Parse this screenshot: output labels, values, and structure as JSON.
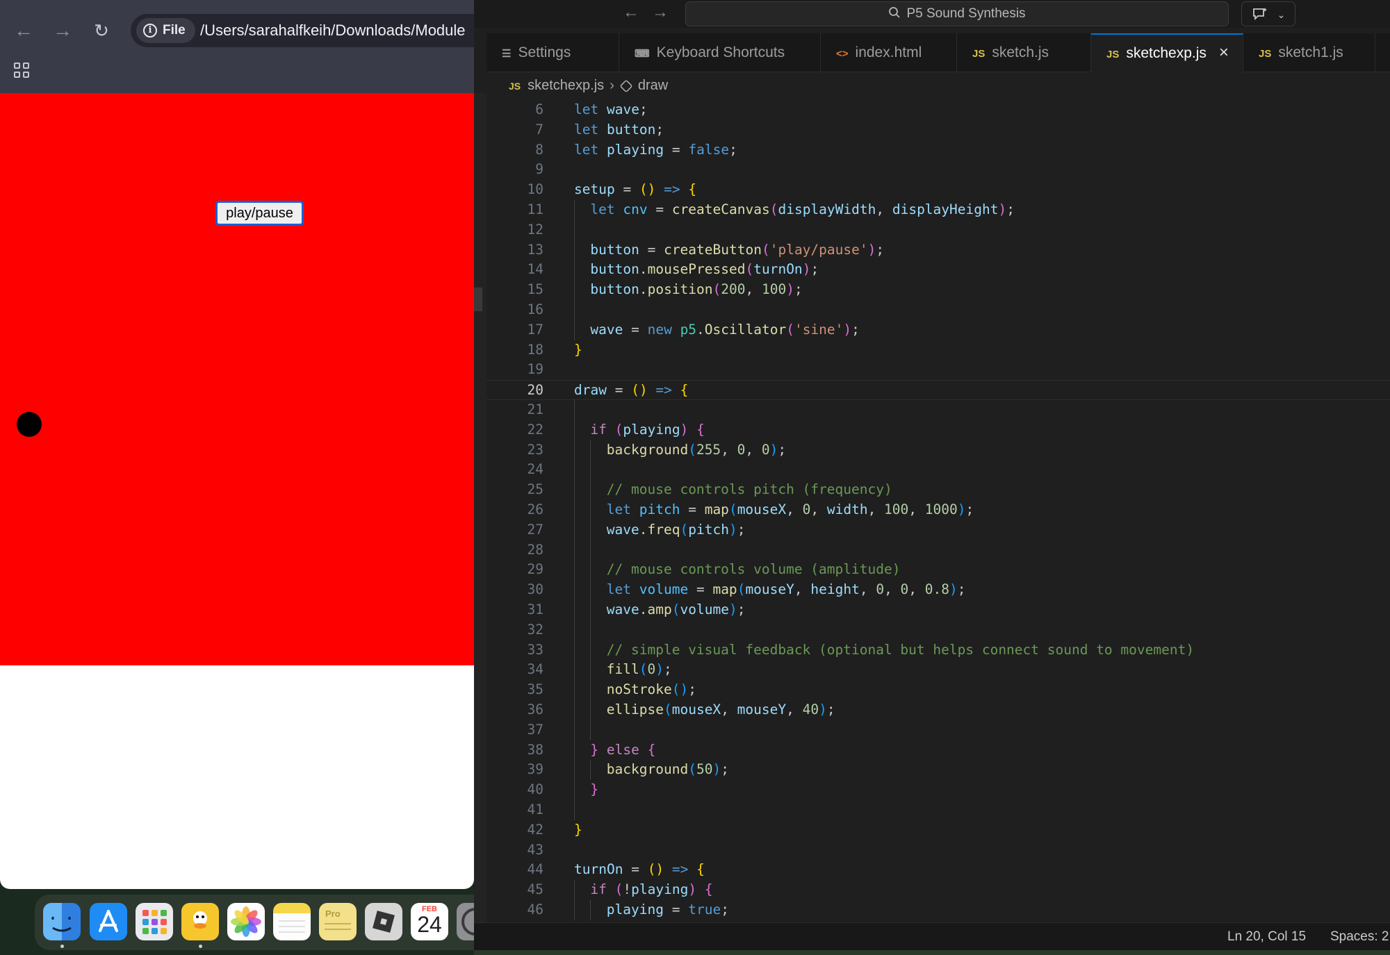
{
  "browser": {
    "file_chip_label": "File",
    "url": "/Users/sarahalfkeih/Downloads/Module",
    "canvas_bg": "#ff0000",
    "play_button_label": "play/pause"
  },
  "dock": {
    "calendar_month": "FEB",
    "calendar_day": "24",
    "notes_label": "Pro"
  },
  "vscode": {
    "command_center": "P5 Sound Synthesis",
    "tabs": [
      {
        "label": "Settings",
        "icon": "gear-icon"
      },
      {
        "label": "Keyboard Shortcuts",
        "icon": "keyboard-icon"
      },
      {
        "label": "index.html",
        "icon": "html-icon"
      },
      {
        "label": "sketch.js",
        "icon": "js-icon"
      },
      {
        "label": "sketchexp.js",
        "icon": "js-icon",
        "active": true
      },
      {
        "label": "sketch1.js",
        "icon": "js-icon"
      }
    ],
    "breadcrumb": {
      "file": "sketchexp.js",
      "symbol": "draw"
    },
    "status": {
      "position": "Ln 20, Col 15",
      "spaces": "Spaces: 2"
    }
  },
  "code_lines": [
    {
      "n": "6",
      "indent": 0,
      "t": [
        [
          "kw",
          "let "
        ],
        [
          "var",
          "wave"
        ],
        [
          "p",
          ";"
        ]
      ]
    },
    {
      "n": "7",
      "indent": 0,
      "t": [
        [
          "kw",
          "let "
        ],
        [
          "var",
          "button"
        ],
        [
          "p",
          ";"
        ]
      ]
    },
    {
      "n": "8",
      "indent": 0,
      "t": [
        [
          "kw",
          "let "
        ],
        [
          "var",
          "playing"
        ],
        [
          "p",
          " = "
        ],
        [
          "kw",
          "false"
        ],
        [
          "p",
          ";"
        ]
      ]
    },
    {
      "n": "9",
      "indent": 0,
      "t": []
    },
    {
      "n": "10",
      "indent": 0,
      "t": [
        [
          "var",
          "setup"
        ],
        [
          "p",
          " = "
        ],
        [
          "b1",
          "()"
        ],
        [
          "kw",
          " => "
        ],
        [
          "b1",
          "{"
        ]
      ]
    },
    {
      "n": "11",
      "indent": 1,
      "t": [
        [
          "kw",
          "let "
        ],
        [
          "const",
          "cnv"
        ],
        [
          "p",
          " = "
        ],
        [
          "fn",
          "createCanvas"
        ],
        [
          "b2",
          "("
        ],
        [
          "var",
          "displayWidth"
        ],
        [
          "p",
          ", "
        ],
        [
          "var",
          "displayHeight"
        ],
        [
          "b2",
          ")"
        ],
        [
          "p",
          ";"
        ]
      ]
    },
    {
      "n": "12",
      "indent": 1,
      "t": []
    },
    {
      "n": "13",
      "indent": 1,
      "t": [
        [
          "var",
          "button"
        ],
        [
          "p",
          " = "
        ],
        [
          "fn",
          "createButton"
        ],
        [
          "b2",
          "("
        ],
        [
          "str",
          "'play/pause'"
        ],
        [
          "b2",
          ")"
        ],
        [
          "p",
          ";"
        ]
      ]
    },
    {
      "n": "14",
      "indent": 1,
      "t": [
        [
          "var",
          "button"
        ],
        [
          "p",
          "."
        ],
        [
          "fn",
          "mousePressed"
        ],
        [
          "b2",
          "("
        ],
        [
          "var",
          "turnOn"
        ],
        [
          "b2",
          ")"
        ],
        [
          "p",
          ";"
        ]
      ]
    },
    {
      "n": "15",
      "indent": 1,
      "t": [
        [
          "var",
          "button"
        ],
        [
          "p",
          "."
        ],
        [
          "fn",
          "position"
        ],
        [
          "b2",
          "("
        ],
        [
          "num",
          "200"
        ],
        [
          "p",
          ", "
        ],
        [
          "num",
          "100"
        ],
        [
          "b2",
          ")"
        ],
        [
          "p",
          ";"
        ]
      ]
    },
    {
      "n": "16",
      "indent": 1,
      "t": []
    },
    {
      "n": "17",
      "indent": 1,
      "t": [
        [
          "var",
          "wave"
        ],
        [
          "p",
          " = "
        ],
        [
          "kw",
          "new "
        ],
        [
          "cls",
          "p5"
        ],
        [
          "p",
          "."
        ],
        [
          "fn",
          "Oscillator"
        ],
        [
          "b2",
          "("
        ],
        [
          "str",
          "'sine'"
        ],
        [
          "b2",
          ")"
        ],
        [
          "p",
          ";"
        ]
      ]
    },
    {
      "n": "18",
      "indent": 0,
      "t": [
        [
          "b1",
          "}"
        ]
      ]
    },
    {
      "n": "19",
      "indent": 0,
      "t": []
    },
    {
      "n": "20",
      "indent": 0,
      "t": [
        [
          "var",
          "draw"
        ],
        [
          "p",
          " = "
        ],
        [
          "b1",
          "()"
        ],
        [
          "kw",
          " => "
        ],
        [
          "b1",
          "{"
        ]
      ],
      "current": true
    },
    {
      "n": "21",
      "indent": 1,
      "t": []
    },
    {
      "n": "22",
      "indent": 1,
      "t": [
        [
          "ctl",
          "if "
        ],
        [
          "b2",
          "("
        ],
        [
          "var",
          "playing"
        ],
        [
          "b2",
          ")"
        ],
        [
          "p",
          " "
        ],
        [
          "b2",
          "{"
        ]
      ]
    },
    {
      "n": "23",
      "indent": 2,
      "t": [
        [
          "fn",
          "background"
        ],
        [
          "b3",
          "("
        ],
        [
          "num",
          "255"
        ],
        [
          "p",
          ", "
        ],
        [
          "num",
          "0"
        ],
        [
          "p",
          ", "
        ],
        [
          "num",
          "0"
        ],
        [
          "b3",
          ")"
        ],
        [
          "p",
          ";"
        ]
      ]
    },
    {
      "n": "24",
      "indent": 2,
      "t": []
    },
    {
      "n": "25",
      "indent": 2,
      "t": [
        [
          "cmt",
          "// mouse controls pitch (frequency)"
        ]
      ]
    },
    {
      "n": "26",
      "indent": 2,
      "t": [
        [
          "kw",
          "let "
        ],
        [
          "const",
          "pitch"
        ],
        [
          "p",
          " = "
        ],
        [
          "fn",
          "map"
        ],
        [
          "b3",
          "("
        ],
        [
          "var",
          "mouseX"
        ],
        [
          "p",
          ", "
        ],
        [
          "num",
          "0"
        ],
        [
          "p",
          ", "
        ],
        [
          "var",
          "width"
        ],
        [
          "p",
          ", "
        ],
        [
          "num",
          "100"
        ],
        [
          "p",
          ", "
        ],
        [
          "num",
          "1000"
        ],
        [
          "b3",
          ")"
        ],
        [
          "p",
          ";"
        ]
      ]
    },
    {
      "n": "27",
      "indent": 2,
      "t": [
        [
          "var",
          "wave"
        ],
        [
          "p",
          "."
        ],
        [
          "fn",
          "freq"
        ],
        [
          "b3",
          "("
        ],
        [
          "var",
          "pitch"
        ],
        [
          "b3",
          ")"
        ],
        [
          "p",
          ";"
        ]
      ]
    },
    {
      "n": "28",
      "indent": 2,
      "t": []
    },
    {
      "n": "29",
      "indent": 2,
      "t": [
        [
          "cmt",
          "// mouse controls volume (amplitude)"
        ]
      ]
    },
    {
      "n": "30",
      "indent": 2,
      "t": [
        [
          "kw",
          "let "
        ],
        [
          "const",
          "volume"
        ],
        [
          "p",
          " = "
        ],
        [
          "fn",
          "map"
        ],
        [
          "b3",
          "("
        ],
        [
          "var",
          "mouseY"
        ],
        [
          "p",
          ", "
        ],
        [
          "var",
          "height"
        ],
        [
          "p",
          ", "
        ],
        [
          "num",
          "0"
        ],
        [
          "p",
          ", "
        ],
        [
          "num",
          "0"
        ],
        [
          "p",
          ", "
        ],
        [
          "num",
          "0.8"
        ],
        [
          "b3",
          ")"
        ],
        [
          "p",
          ";"
        ]
      ]
    },
    {
      "n": "31",
      "indent": 2,
      "t": [
        [
          "var",
          "wave"
        ],
        [
          "p",
          "."
        ],
        [
          "fn",
          "amp"
        ],
        [
          "b3",
          "("
        ],
        [
          "var",
          "volume"
        ],
        [
          "b3",
          ")"
        ],
        [
          "p",
          ";"
        ]
      ]
    },
    {
      "n": "32",
      "indent": 2,
      "t": []
    },
    {
      "n": "33",
      "indent": 2,
      "t": [
        [
          "cmt",
          "// simple visual feedback (optional but helps connect sound to movement)"
        ]
      ]
    },
    {
      "n": "34",
      "indent": 2,
      "t": [
        [
          "fn",
          "fill"
        ],
        [
          "b3",
          "("
        ],
        [
          "num",
          "0"
        ],
        [
          "b3",
          ")"
        ],
        [
          "p",
          ";"
        ]
      ]
    },
    {
      "n": "35",
      "indent": 2,
      "t": [
        [
          "fn",
          "noStroke"
        ],
        [
          "b3",
          "()"
        ],
        [
          "p",
          ";"
        ]
      ]
    },
    {
      "n": "36",
      "indent": 2,
      "t": [
        [
          "fn",
          "ellipse"
        ],
        [
          "b3",
          "("
        ],
        [
          "var",
          "mouseX"
        ],
        [
          "p",
          ", "
        ],
        [
          "var",
          "mouseY"
        ],
        [
          "p",
          ", "
        ],
        [
          "num",
          "40"
        ],
        [
          "b3",
          ")"
        ],
        [
          "p",
          ";"
        ]
      ]
    },
    {
      "n": "37",
      "indent": 2,
      "t": []
    },
    {
      "n": "38",
      "indent": 1,
      "t": [
        [
          "b2",
          "} "
        ],
        [
          "ctl",
          "else "
        ],
        [
          "b2",
          "{"
        ]
      ]
    },
    {
      "n": "39",
      "indent": 2,
      "t": [
        [
          "fn",
          "background"
        ],
        [
          "b3",
          "("
        ],
        [
          "num",
          "50"
        ],
        [
          "b3",
          ")"
        ],
        [
          "p",
          ";"
        ]
      ]
    },
    {
      "n": "40",
      "indent": 1,
      "t": [
        [
          "b2",
          "}"
        ]
      ]
    },
    {
      "n": "41",
      "indent": 1,
      "t": []
    },
    {
      "n": "42",
      "indent": 0,
      "t": [
        [
          "b1",
          "}"
        ]
      ]
    },
    {
      "n": "43",
      "indent": 0,
      "t": []
    },
    {
      "n": "44",
      "indent": 0,
      "t": [
        [
          "var",
          "turnOn"
        ],
        [
          "p",
          " = "
        ],
        [
          "b1",
          "()"
        ],
        [
          "kw",
          " => "
        ],
        [
          "b1",
          "{"
        ]
      ]
    },
    {
      "n": "45",
      "indent": 1,
      "t": [
        [
          "ctl",
          "if "
        ],
        [
          "b2",
          "("
        ],
        [
          "p",
          "!"
        ],
        [
          "var",
          "playing"
        ],
        [
          "b2",
          ")"
        ],
        [
          "p",
          " "
        ],
        [
          "b2",
          "{"
        ]
      ]
    },
    {
      "n": "46",
      "indent": 2,
      "t": [
        [
          "var",
          "playing"
        ],
        [
          "p",
          " = "
        ],
        [
          "kw",
          "true"
        ],
        [
          "p",
          ";"
        ]
      ]
    }
  ],
  "syntax_colors": {
    "kw": "#569cd6",
    "var": "#9cdcfe",
    "const": "#4fc1ff",
    "fn": "#dcdcaa",
    "str": "#ce9178",
    "num": "#b5cea8",
    "cmt": "#6a9955",
    "ctl": "#c586c0",
    "cls": "#4ec9b0",
    "p": "#cccccc",
    "b1": "#ffd700",
    "b2": "#da70d6",
    "b3": "#179fff"
  }
}
